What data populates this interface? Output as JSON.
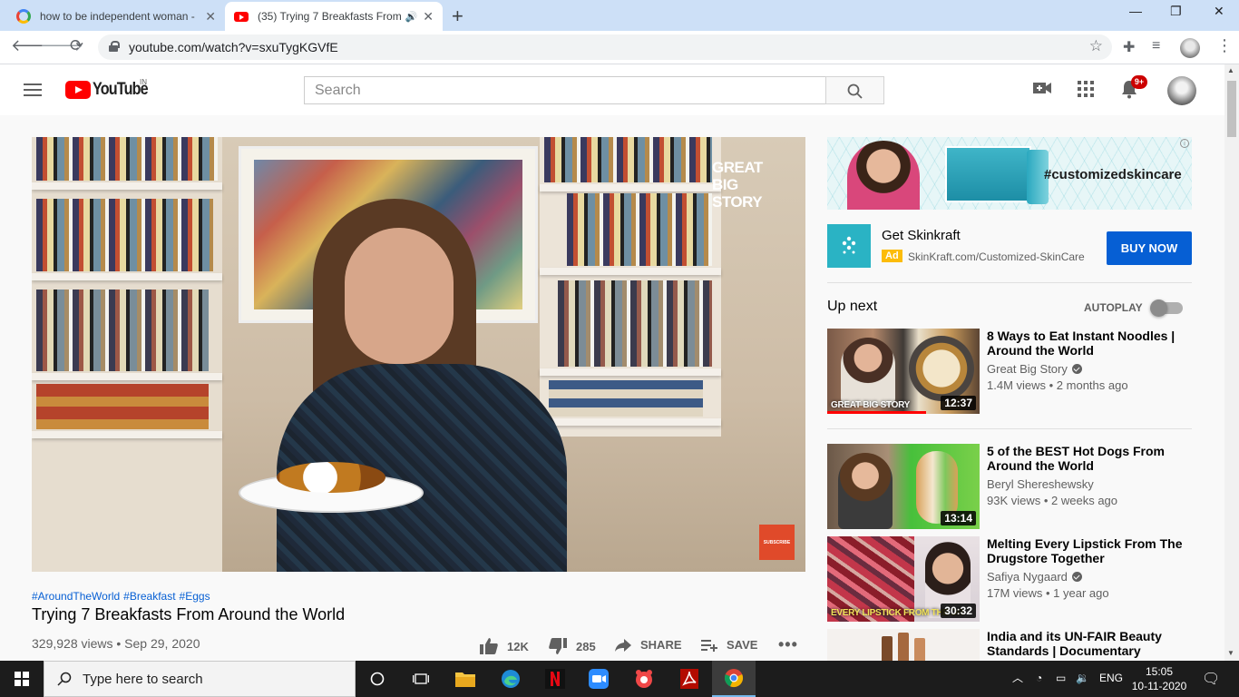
{
  "browser": {
    "tabs": [
      {
        "title": "how to be independent woman -",
        "active": false
      },
      {
        "title": "(35) Trying 7 Breakfasts From",
        "active": true
      }
    ],
    "new_tab_label": "+",
    "url": "youtube.com/watch?v=sxuTygKGVfE",
    "window_controls": [
      "—",
      "❐",
      "✕"
    ]
  },
  "youtube": {
    "logo_text": "YouTube",
    "logo_country": "IN",
    "search_placeholder": "Search",
    "notification_count": "9+"
  },
  "video": {
    "overlay_brand": "GREAT BIG STORY",
    "subscribe_overlay": "SUBSCRIBE",
    "hashtags": [
      "#AroundTheWorld",
      "#Breakfast",
      "#Eggs"
    ],
    "title": "Trying 7 Breakfasts From Around the World",
    "views_date": "329,928 views • Sep 29, 2020",
    "likes": "12K",
    "dislikes": "285",
    "share_label": "SHARE",
    "save_label": "SAVE"
  },
  "ad": {
    "banner_tag": "#customizedskincare",
    "name": "Get Skinkraft",
    "label": "Ad",
    "url": "SkinKraft.com/Customized-SkinCare",
    "cta": "BUY NOW"
  },
  "sidebar": {
    "up_next_label": "Up next",
    "autoplay_label": "AUTOPLAY",
    "autoplay_on": false,
    "recommendations": [
      {
        "title": "8 Ways to Eat Instant Noodles | Around the World",
        "channel": "Great Big Story",
        "verified": true,
        "meta": "1.4M views • 2 months ago",
        "duration": "12:37",
        "caption": "GREAT BIG STORY",
        "watched_fraction": 0.65
      },
      {
        "title": "5 of the BEST Hot Dogs From Around the World",
        "channel": "Beryl Shereshewsky",
        "verified": false,
        "meta": "93K views • 2 weeks ago",
        "duration": "13:14",
        "caption": ""
      },
      {
        "title": "Melting Every Lipstick From The Drugstore Together",
        "channel": "Safiya Nygaard",
        "verified": true,
        "meta": "17M views • 1 year ago",
        "duration": "30:32",
        "caption": "EVERY LIPSTICK FROM THE DR"
      },
      {
        "title": "India and its UN-FAIR Beauty Standards | Documentary",
        "channel": "",
        "verified": false,
        "meta": "",
        "duration": "",
        "caption": ""
      }
    ]
  },
  "taskbar": {
    "search_placeholder": "Type here to search",
    "language": "ENG",
    "time": "15:05",
    "date": "10-11-2020"
  }
}
